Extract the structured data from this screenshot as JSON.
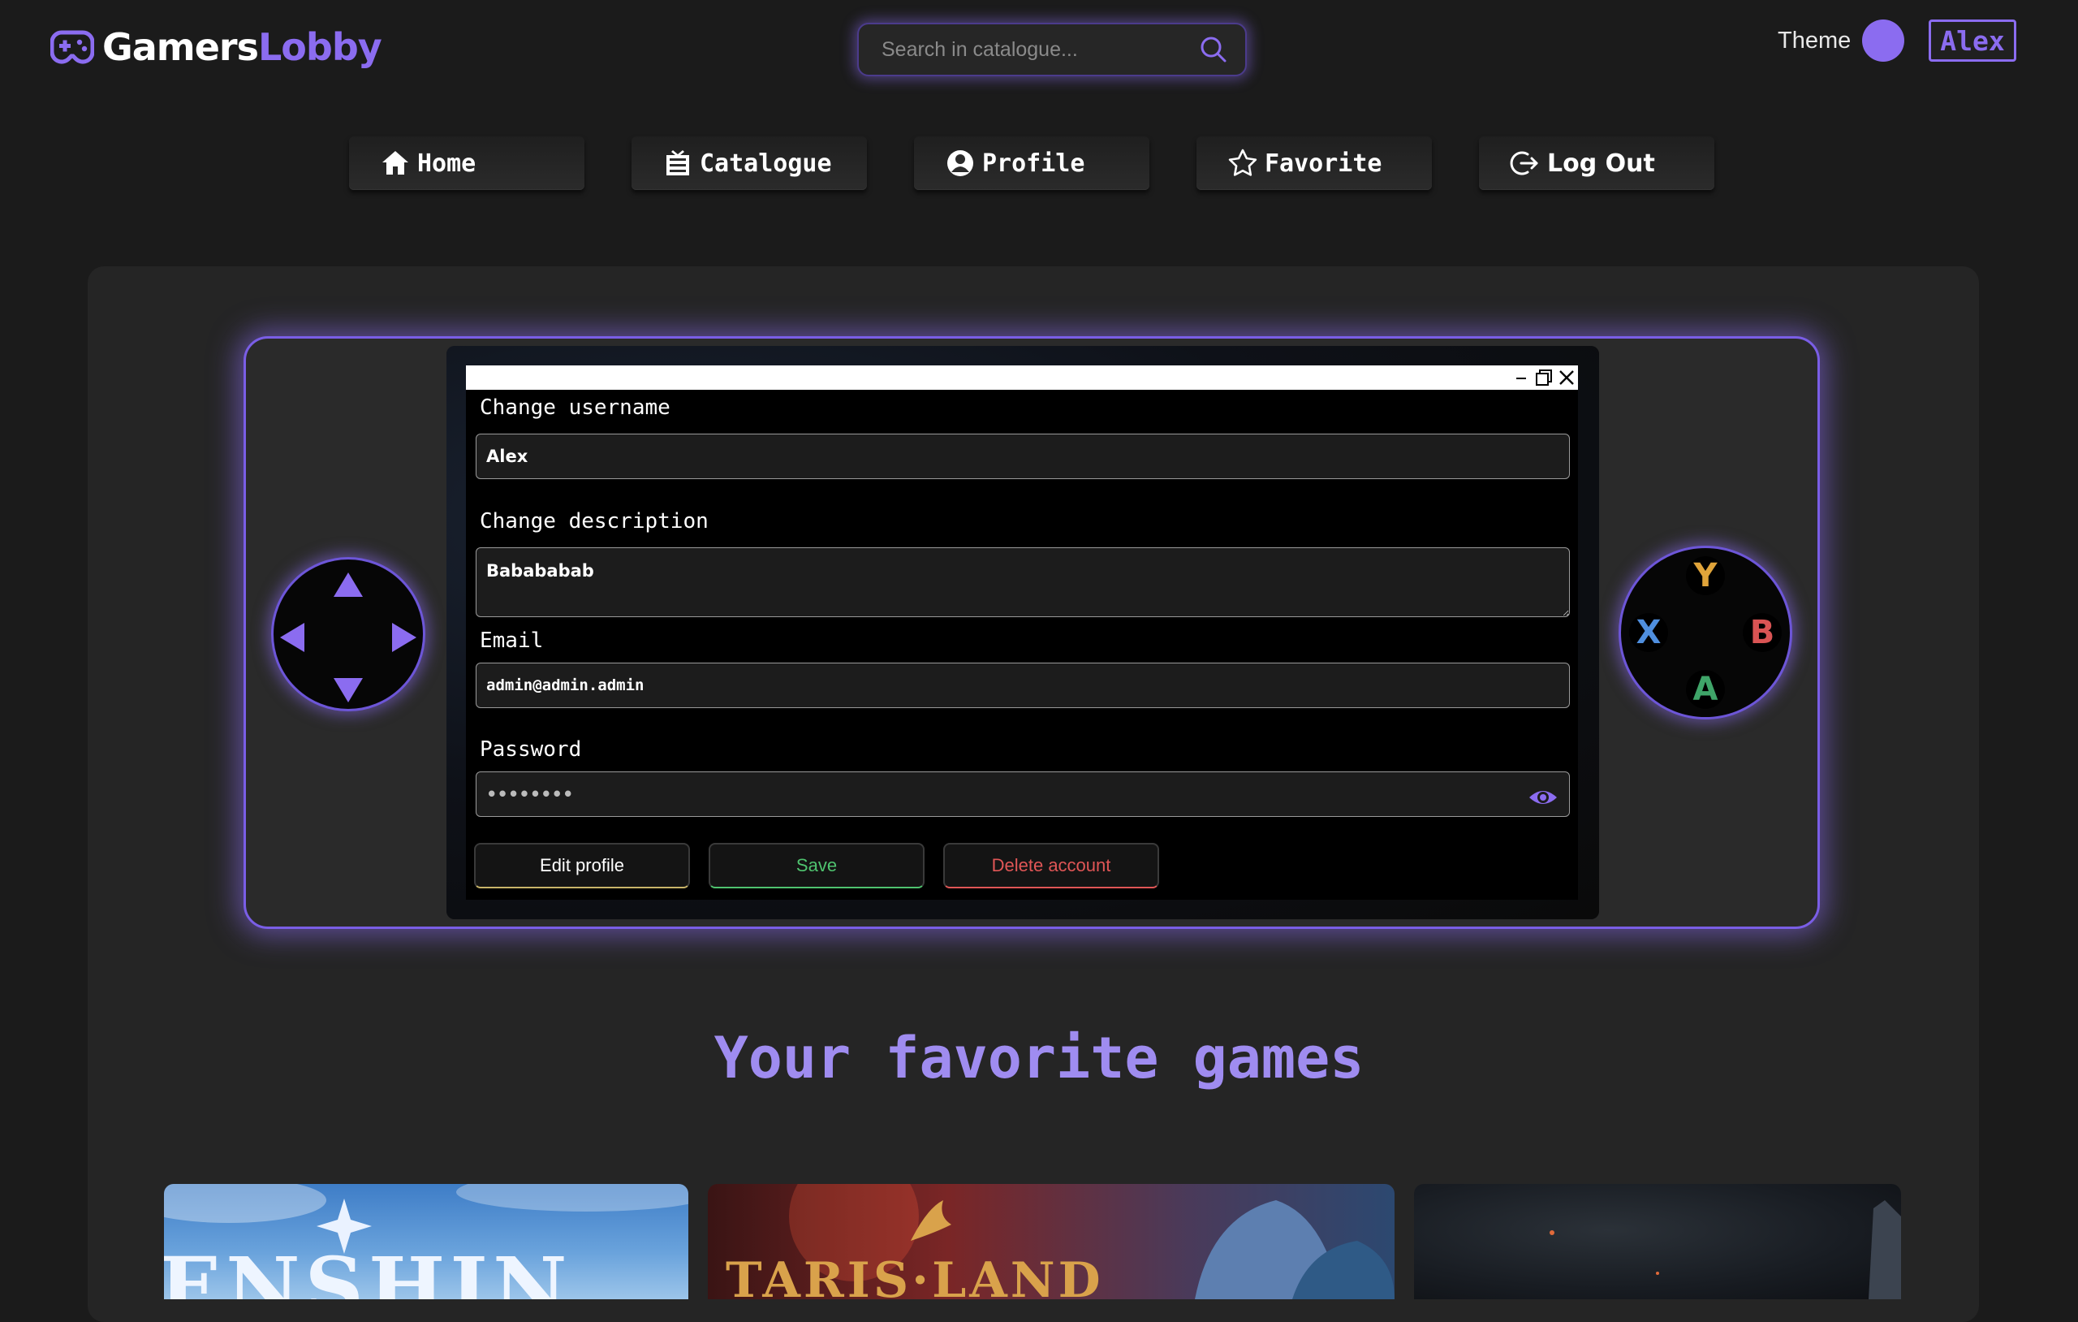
{
  "header": {
    "logo_part1": "Gamers",
    "logo_part2": "Lobby",
    "search_placeholder": "Search in catalogue...",
    "theme_label": "Theme",
    "username": "Alex"
  },
  "nav": [
    {
      "label": "Home",
      "icon": "home-icon"
    },
    {
      "label": "Catalogue",
      "icon": "catalogue-icon"
    },
    {
      "label": "Profile",
      "icon": "profile-icon"
    },
    {
      "label": "Favorite",
      "icon": "star-icon"
    },
    {
      "label": "Log Out",
      "icon": "logout-icon"
    }
  ],
  "profile_form": {
    "username_label": "Change username",
    "username_value": "Alex",
    "description_label": "Change description",
    "description_value": "Babababab",
    "email_label": "Email",
    "email_value": "admin@admin.admin",
    "password_label": "Password",
    "password_value": "••••••••",
    "edit_label": "Edit profile",
    "save_label": "Save",
    "delete_label": "Delete account"
  },
  "controller": {
    "buttons": {
      "y": "Y",
      "b": "B",
      "x": "X",
      "a": "A"
    }
  },
  "favorites": {
    "title": "Your favorite games",
    "cards": [
      {
        "name": "ENSHIN",
        "art": "genshin-art"
      },
      {
        "name": "TARIS·LAND",
        "art": "tarisland-art"
      },
      {
        "name": "",
        "art": "dark-game-art"
      }
    ]
  },
  "colors": {
    "accent": "#8b6cf0",
    "background": "#1b1b1b",
    "panel": "#252525",
    "save_green": "#4fc36f",
    "delete_red": "#e05656",
    "edit_yellow": "#c8b469",
    "y_color": "#e0a43a",
    "b_color": "#d95454",
    "x_color": "#4f8fdf",
    "a_color": "#3fa569"
  }
}
